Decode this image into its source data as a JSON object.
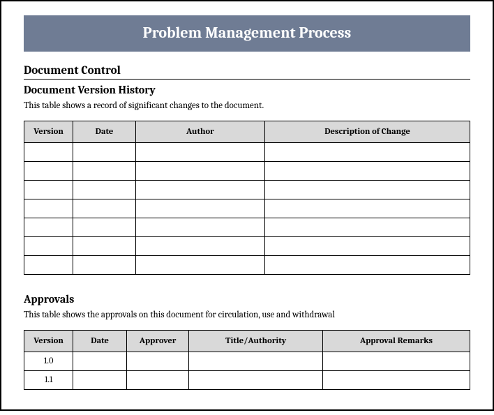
{
  "title": "Problem Management Process",
  "section_control": "Document Control",
  "history": {
    "heading": "Document Version History",
    "caption": "This table shows a record of significant changes to the document.",
    "columns": [
      "Version",
      "Date",
      "Author",
      "Description of Change"
    ],
    "rows": [
      {
        "version": "",
        "date": "",
        "author": "",
        "desc": ""
      },
      {
        "version": "",
        "date": "",
        "author": "",
        "desc": ""
      },
      {
        "version": "",
        "date": "",
        "author": "",
        "desc": ""
      },
      {
        "version": "",
        "date": "",
        "author": "",
        "desc": ""
      },
      {
        "version": "",
        "date": "",
        "author": "",
        "desc": ""
      },
      {
        "version": "",
        "date": "",
        "author": "",
        "desc": ""
      },
      {
        "version": "",
        "date": "",
        "author": "",
        "desc": ""
      }
    ]
  },
  "approvals": {
    "heading": "Approvals",
    "caption": "This table shows the approvals on this document for circulation, use and withdrawal",
    "columns": [
      "Version",
      "Date",
      "Approver",
      "Title/Authority",
      "Approval Remarks"
    ],
    "rows": [
      {
        "version": "1.0",
        "date": "",
        "approver": "",
        "title": "",
        "remarks": ""
      },
      {
        "version": "1.1",
        "date": "",
        "approver": "",
        "title": "",
        "remarks": ""
      }
    ]
  }
}
